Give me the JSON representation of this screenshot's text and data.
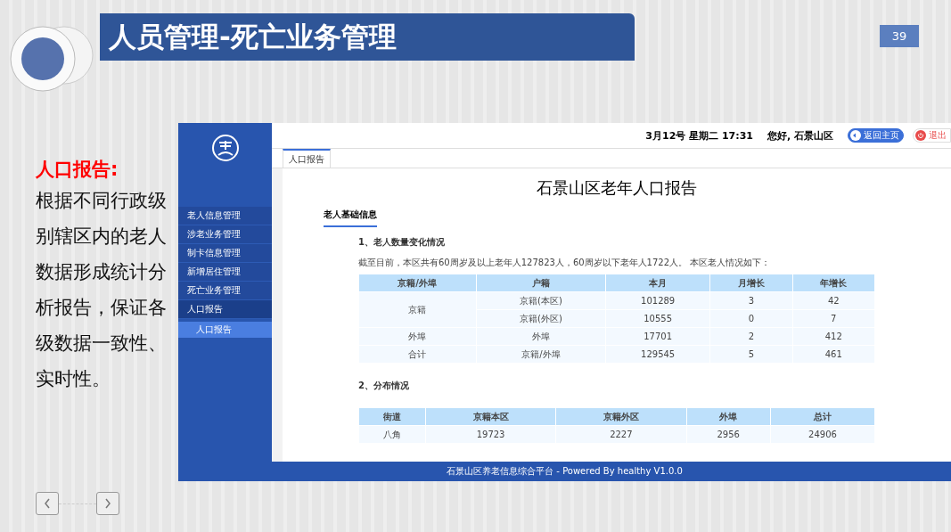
{
  "slide": {
    "title": "人员管理-死亡业务管理",
    "page_number": "39",
    "intro": {
      "heading": "人口报告:",
      "body": "根据不同行政级别辖区内的老人数据形成统计分析报告，保证各级数据一致性、实时性。"
    }
  },
  "app": {
    "sidebar": {
      "items": [
        {
          "label": "老人信息管理",
          "selected": false
        },
        {
          "label": "涉老业务管理",
          "selected": false
        },
        {
          "label": "制卡信息管理",
          "selected": false
        },
        {
          "label": "新增居住管理",
          "selected": false
        },
        {
          "label": "死亡业务管理",
          "selected": false
        },
        {
          "label": "人口报告",
          "selected": false,
          "expanded": true,
          "children": [
            {
              "label": "人口报告",
              "selected": true
            }
          ]
        }
      ]
    },
    "topbar": {
      "datetime": "3月12号 星期二 17:31",
      "greeting": "您好, 石景山区",
      "home_button": "返回主页",
      "logout_button": "退出"
    },
    "tabs": [
      {
        "label": "人口报告",
        "selected": true
      }
    ],
    "report": {
      "title": "石景山区老年人口报告",
      "section": "老人基础信息",
      "sub1": "1、老人数量变化情况",
      "summary": "截至目前，本区共有60周岁及以上老年人127823人，60周岁以下老年人1722人。 本区老人情况如下：",
      "table1": {
        "columns": [
          "京籍/外埠",
          "户籍",
          "本月",
          "月增长",
          "年增长"
        ],
        "groups": [
          {
            "label": "京籍",
            "rows": [
              [
                "京籍(本区)",
                "101289",
                "3",
                "42"
              ],
              [
                "京籍(外区)",
                "10555",
                "0",
                "7"
              ]
            ]
          },
          {
            "label": "外埠",
            "rows": [
              [
                "外埠",
                "17701",
                "2",
                "412"
              ]
            ]
          },
          {
            "label": "合计",
            "rows": [
              [
                "京籍/外埠",
                "129545",
                "5",
                "461"
              ]
            ]
          }
        ]
      },
      "sub2": "2、分布情况",
      "table2": {
        "columns": [
          "街道",
          "京籍本区",
          "京籍外区",
          "外埠",
          "总计"
        ],
        "rows": [
          [
            "八角",
            "19723",
            "2227",
            "2956",
            "24906"
          ]
        ]
      }
    },
    "footer": "石景山区养老信息综合平台 - Powered By healthy V1.0.0"
  }
}
